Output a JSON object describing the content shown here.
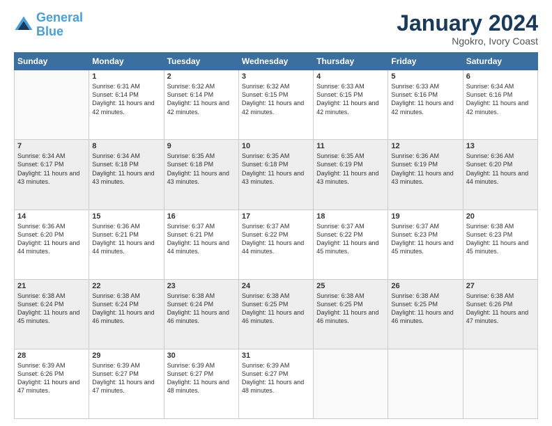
{
  "logo": {
    "line1": "General",
    "line2": "Blue"
  },
  "title": "January 2024",
  "subtitle": "Ngokro, Ivory Coast",
  "days": [
    "Sunday",
    "Monday",
    "Tuesday",
    "Wednesday",
    "Thursday",
    "Friday",
    "Saturday"
  ],
  "weeks": [
    [
      {
        "day": "",
        "sunrise": "",
        "sunset": "",
        "daylight": ""
      },
      {
        "day": "1",
        "sunrise": "Sunrise: 6:31 AM",
        "sunset": "Sunset: 6:14 PM",
        "daylight": "Daylight: 11 hours and 42 minutes."
      },
      {
        "day": "2",
        "sunrise": "Sunrise: 6:32 AM",
        "sunset": "Sunset: 6:14 PM",
        "daylight": "Daylight: 11 hours and 42 minutes."
      },
      {
        "day": "3",
        "sunrise": "Sunrise: 6:32 AM",
        "sunset": "Sunset: 6:15 PM",
        "daylight": "Daylight: 11 hours and 42 minutes."
      },
      {
        "day": "4",
        "sunrise": "Sunrise: 6:33 AM",
        "sunset": "Sunset: 6:15 PM",
        "daylight": "Daylight: 11 hours and 42 minutes."
      },
      {
        "day": "5",
        "sunrise": "Sunrise: 6:33 AM",
        "sunset": "Sunset: 6:16 PM",
        "daylight": "Daylight: 11 hours and 42 minutes."
      },
      {
        "day": "6",
        "sunrise": "Sunrise: 6:34 AM",
        "sunset": "Sunset: 6:16 PM",
        "daylight": "Daylight: 11 hours and 42 minutes."
      }
    ],
    [
      {
        "day": "7",
        "sunrise": "Sunrise: 6:34 AM",
        "sunset": "Sunset: 6:17 PM",
        "daylight": "Daylight: 11 hours and 43 minutes."
      },
      {
        "day": "8",
        "sunrise": "Sunrise: 6:34 AM",
        "sunset": "Sunset: 6:18 PM",
        "daylight": "Daylight: 11 hours and 43 minutes."
      },
      {
        "day": "9",
        "sunrise": "Sunrise: 6:35 AM",
        "sunset": "Sunset: 6:18 PM",
        "daylight": "Daylight: 11 hours and 43 minutes."
      },
      {
        "day": "10",
        "sunrise": "Sunrise: 6:35 AM",
        "sunset": "Sunset: 6:18 PM",
        "daylight": "Daylight: 11 hours and 43 minutes."
      },
      {
        "day": "11",
        "sunrise": "Sunrise: 6:35 AM",
        "sunset": "Sunset: 6:19 PM",
        "daylight": "Daylight: 11 hours and 43 minutes."
      },
      {
        "day": "12",
        "sunrise": "Sunrise: 6:36 AM",
        "sunset": "Sunset: 6:19 PM",
        "daylight": "Daylight: 11 hours and 43 minutes."
      },
      {
        "day": "13",
        "sunrise": "Sunrise: 6:36 AM",
        "sunset": "Sunset: 6:20 PM",
        "daylight": "Daylight: 11 hours and 44 minutes."
      }
    ],
    [
      {
        "day": "14",
        "sunrise": "Sunrise: 6:36 AM",
        "sunset": "Sunset: 6:20 PM",
        "daylight": "Daylight: 11 hours and 44 minutes."
      },
      {
        "day": "15",
        "sunrise": "Sunrise: 6:36 AM",
        "sunset": "Sunset: 6:21 PM",
        "daylight": "Daylight: 11 hours and 44 minutes."
      },
      {
        "day": "16",
        "sunrise": "Sunrise: 6:37 AM",
        "sunset": "Sunset: 6:21 PM",
        "daylight": "Daylight: 11 hours and 44 minutes."
      },
      {
        "day": "17",
        "sunrise": "Sunrise: 6:37 AM",
        "sunset": "Sunset: 6:22 PM",
        "daylight": "Daylight: 11 hours and 44 minutes."
      },
      {
        "day": "18",
        "sunrise": "Sunrise: 6:37 AM",
        "sunset": "Sunset: 6:22 PM",
        "daylight": "Daylight: 11 hours and 45 minutes."
      },
      {
        "day": "19",
        "sunrise": "Sunrise: 6:37 AM",
        "sunset": "Sunset: 6:23 PM",
        "daylight": "Daylight: 11 hours and 45 minutes."
      },
      {
        "day": "20",
        "sunrise": "Sunrise: 6:38 AM",
        "sunset": "Sunset: 6:23 PM",
        "daylight": "Daylight: 11 hours and 45 minutes."
      }
    ],
    [
      {
        "day": "21",
        "sunrise": "Sunrise: 6:38 AM",
        "sunset": "Sunset: 6:24 PM",
        "daylight": "Daylight: 11 hours and 45 minutes."
      },
      {
        "day": "22",
        "sunrise": "Sunrise: 6:38 AM",
        "sunset": "Sunset: 6:24 PM",
        "daylight": "Daylight: 11 hours and 46 minutes."
      },
      {
        "day": "23",
        "sunrise": "Sunrise: 6:38 AM",
        "sunset": "Sunset: 6:24 PM",
        "daylight": "Daylight: 11 hours and 46 minutes."
      },
      {
        "day": "24",
        "sunrise": "Sunrise: 6:38 AM",
        "sunset": "Sunset: 6:25 PM",
        "daylight": "Daylight: 11 hours and 46 minutes."
      },
      {
        "day": "25",
        "sunrise": "Sunrise: 6:38 AM",
        "sunset": "Sunset: 6:25 PM",
        "daylight": "Daylight: 11 hours and 46 minutes."
      },
      {
        "day": "26",
        "sunrise": "Sunrise: 6:38 AM",
        "sunset": "Sunset: 6:25 PM",
        "daylight": "Daylight: 11 hours and 46 minutes."
      },
      {
        "day": "27",
        "sunrise": "Sunrise: 6:38 AM",
        "sunset": "Sunset: 6:26 PM",
        "daylight": "Daylight: 11 hours and 47 minutes."
      }
    ],
    [
      {
        "day": "28",
        "sunrise": "Sunrise: 6:39 AM",
        "sunset": "Sunset: 6:26 PM",
        "daylight": "Daylight: 11 hours and 47 minutes."
      },
      {
        "day": "29",
        "sunrise": "Sunrise: 6:39 AM",
        "sunset": "Sunset: 6:27 PM",
        "daylight": "Daylight: 11 hours and 47 minutes."
      },
      {
        "day": "30",
        "sunrise": "Sunrise: 6:39 AM",
        "sunset": "Sunset: 6:27 PM",
        "daylight": "Daylight: 11 hours and 48 minutes."
      },
      {
        "day": "31",
        "sunrise": "Sunrise: 6:39 AM",
        "sunset": "Sunset: 6:27 PM",
        "daylight": "Daylight: 11 hours and 48 minutes."
      },
      {
        "day": "",
        "sunrise": "",
        "sunset": "",
        "daylight": ""
      },
      {
        "day": "",
        "sunrise": "",
        "sunset": "",
        "daylight": ""
      },
      {
        "day": "",
        "sunrise": "",
        "sunset": "",
        "daylight": ""
      }
    ]
  ]
}
